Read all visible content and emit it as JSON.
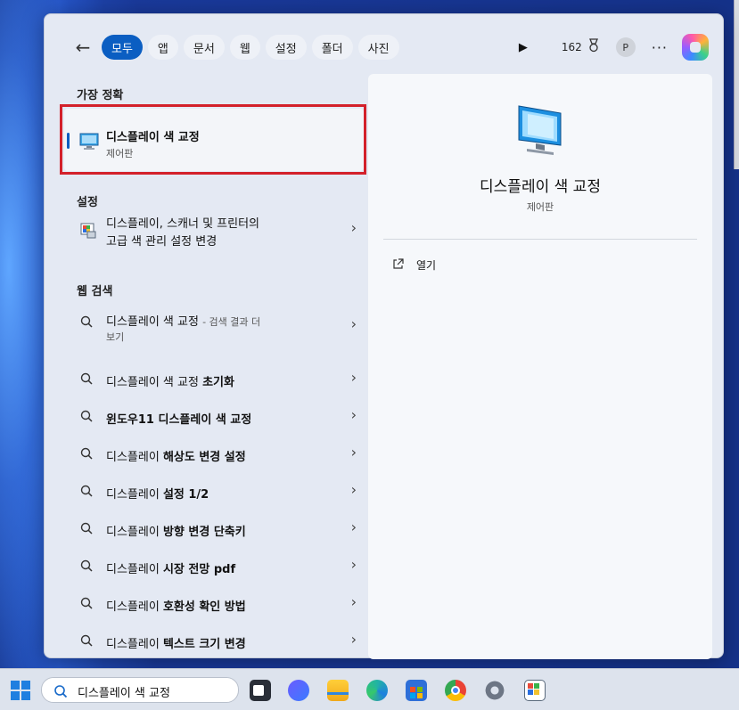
{
  "filters": {
    "back_label": "←",
    "tabs": [
      "모두",
      "앱",
      "문서",
      "웹",
      "설정",
      "폴더",
      "사진"
    ],
    "points": "162",
    "avatar_letter": "P",
    "more": "···"
  },
  "sections": {
    "best_match": "가장 정확",
    "settings": "설정",
    "web": "웹 검색"
  },
  "best_match": {
    "title": "디스플레이 색 교정",
    "subtitle": "제어판"
  },
  "settings_item": {
    "line1": "디스플레이, 스캐너 및 프린터의",
    "line2": "고급 색 관리 설정 변경"
  },
  "web_results": [
    {
      "prefix": "디스플레이 색 교정",
      "suffix": "",
      "hint": "- 검색 결과 더",
      "line2": "보기"
    },
    {
      "prefix": "디스플레이 색 교정 ",
      "suffix": "초기화",
      "hint": "",
      "line2": ""
    },
    {
      "prefix": "",
      "suffix": "윈도우11 디스플레이 색 교정",
      "hint": "",
      "line2": ""
    },
    {
      "prefix": "디스플레이 ",
      "suffix": "해상도 변경 설정",
      "hint": "",
      "line2": ""
    },
    {
      "prefix": "디스플레이 ",
      "suffix": "설정 1/2",
      "hint": "",
      "line2": ""
    },
    {
      "prefix": "디스플레이 ",
      "suffix": "방향 변경 단축키",
      "hint": "",
      "line2": ""
    },
    {
      "prefix": "디스플레이 ",
      "suffix": "시장 전망 pdf",
      "hint": "",
      "line2": ""
    },
    {
      "prefix": "디스플레이 ",
      "suffix": "호환성 확인 방법",
      "hint": "",
      "line2": ""
    },
    {
      "prefix": "디스플레이 ",
      "suffix": "텍스트 크기 변경",
      "hint": "",
      "line2": ""
    }
  ],
  "preview": {
    "title": "디스플레이 색 교정",
    "subtitle": "제어판",
    "action_open": "열기"
  },
  "taskbar": {
    "search_value": "디스플레이 색 교정"
  },
  "colors": {
    "accent": "#0b5ec2",
    "highlight": "#d3202a"
  }
}
